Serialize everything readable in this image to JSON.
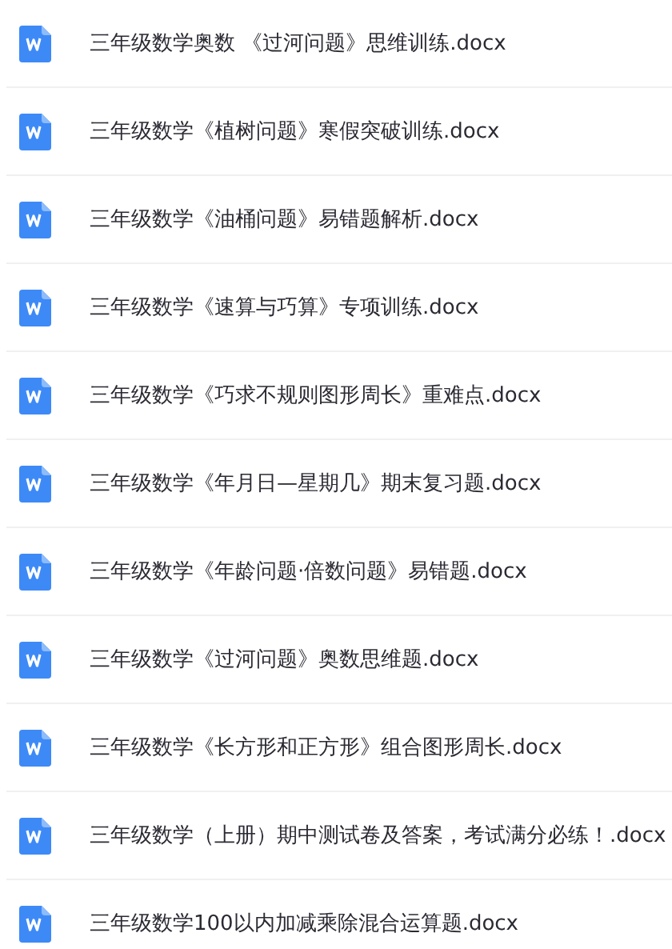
{
  "files": [
    {
      "name": "三年级数学奥数 《过河问题》思维训练.docx",
      "kind": "word"
    },
    {
      "name": "三年级数学《植树问题》寒假突破训练.docx",
      "kind": "word"
    },
    {
      "name": "三年级数学《油桶问题》易错题解析.docx",
      "kind": "word"
    },
    {
      "name": "三年级数学《速算与巧算》专项训练.docx",
      "kind": "word"
    },
    {
      "name": "三年级数学《巧求不规则图形周长》重难点.docx",
      "kind": "word"
    },
    {
      "name": "三年级数学《年月日—星期几》期末复习题.docx",
      "kind": "word"
    },
    {
      "name": "三年级数学《年龄问题·倍数问题》易错题.docx",
      "kind": "word"
    },
    {
      "name": "三年级数学《过河问题》奥数思维题.docx",
      "kind": "word"
    },
    {
      "name": "三年级数学《长方形和正方形》组合图形周长.docx",
      "kind": "word"
    },
    {
      "name": "三年级数学（上册）期中测试卷及答案，考试满分必练！.docx",
      "kind": "word"
    },
    {
      "name": "三年级数学100以内加减乘除混合运算题.docx",
      "kind": "word"
    }
  ]
}
